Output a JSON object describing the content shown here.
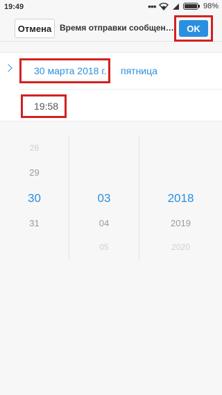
{
  "status_bar": {
    "time": "19:49",
    "dots": "•••",
    "battery": "98%",
    "icons": [
      "wifi-icon",
      "signal-icon",
      "battery-icon"
    ]
  },
  "header": {
    "cancel_label": "Отмена",
    "title": "Время отправки сообщения",
    "ok_label": "OK"
  },
  "schedule": {
    "date": "30 марта 2018 г.",
    "weekday": "пятница",
    "time": "19:58"
  },
  "picker": {
    "day": {
      "far_above": "28",
      "above": "29",
      "selected": "30",
      "below": "31"
    },
    "month": {
      "selected": "03",
      "below": "04",
      "far_below": "05"
    },
    "year": {
      "selected": "2018",
      "below": "2019",
      "far_below": "2020"
    }
  },
  "colors": {
    "accent": "#2a8fe0",
    "highlight": "#d32020"
  }
}
